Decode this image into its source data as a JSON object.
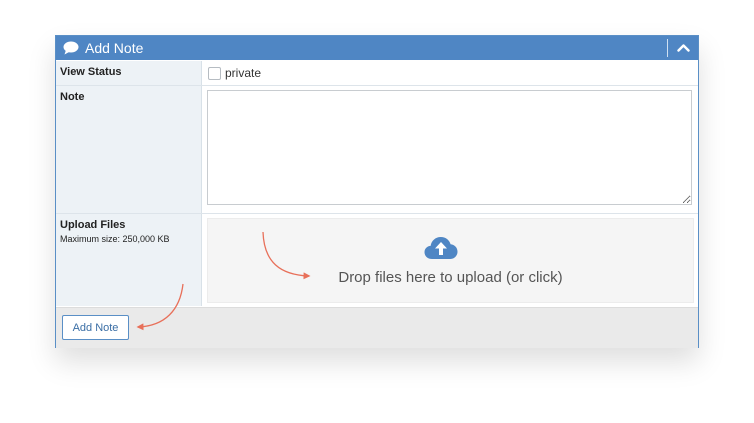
{
  "panel": {
    "title": "Add Note",
    "header_icon": "speech-bubble-icon",
    "collapse_icon": "chevron-up-icon"
  },
  "form": {
    "view_status": {
      "label": "View Status",
      "checkbox_label": "private",
      "checked": false
    },
    "note": {
      "label": "Note",
      "value": ""
    },
    "upload": {
      "label": "Upload Files",
      "max_size": "Maximum size: 250,000 KB",
      "dropzone_text": "Drop files here to upload (or click)",
      "icon": "cloud-upload-icon"
    }
  },
  "footer": {
    "submit_label": "Add Note"
  },
  "colors": {
    "header": "#4f86c4",
    "accent_arrow": "#e8705a",
    "label_bg": "#edf2f6"
  }
}
